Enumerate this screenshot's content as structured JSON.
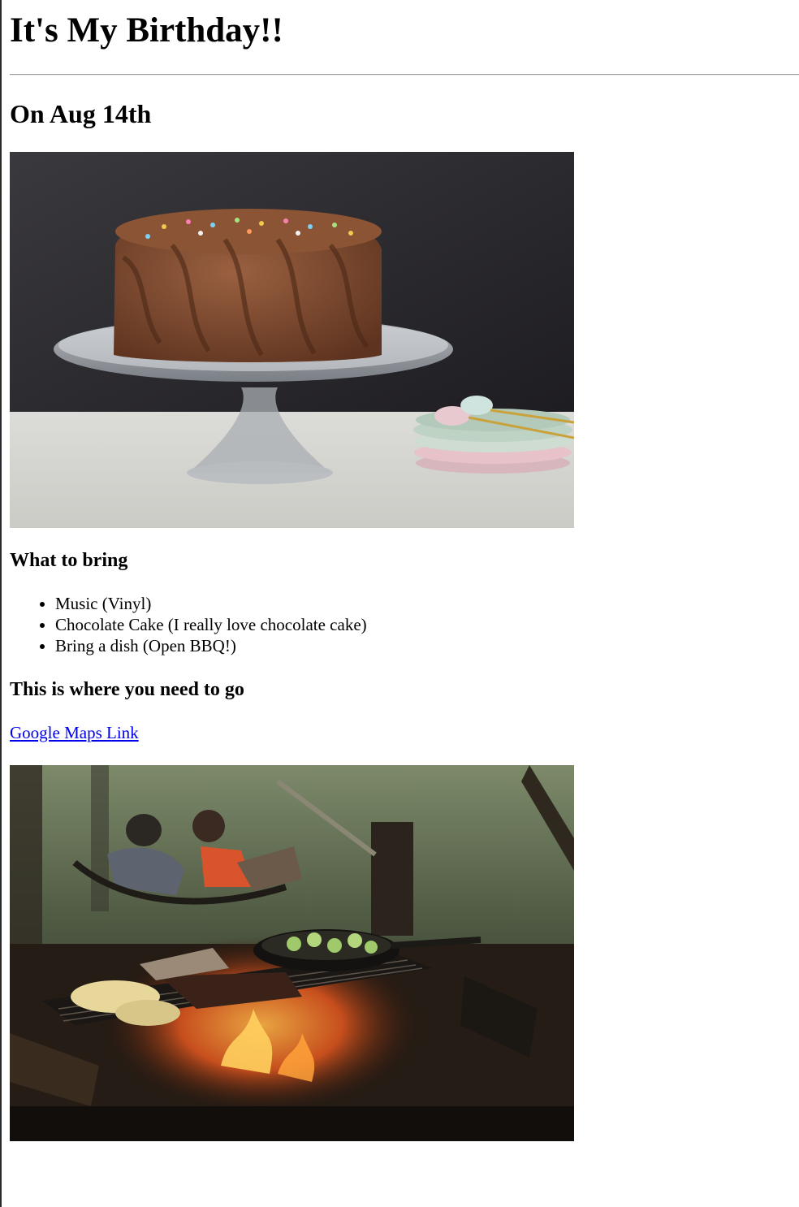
{
  "header": {
    "title": "It's My Birthday!!",
    "date_heading": "On Aug 14th"
  },
  "bring": {
    "heading": "What to bring",
    "items": [
      "Music (Vinyl)",
      "Chocolate Cake (I really love chocolate cake)",
      "Bring a dish (Open BBQ!)"
    ]
  },
  "location": {
    "heading": "This is where you need to go",
    "link_text": "Google Maps Link"
  },
  "images": {
    "cake": "chocolate-cake-on-glass-stand",
    "bbq": "campfire-bbq-in-forest"
  },
  "colors": {
    "link": "#0000ee",
    "text": "#000000",
    "background": "#ffffff"
  }
}
